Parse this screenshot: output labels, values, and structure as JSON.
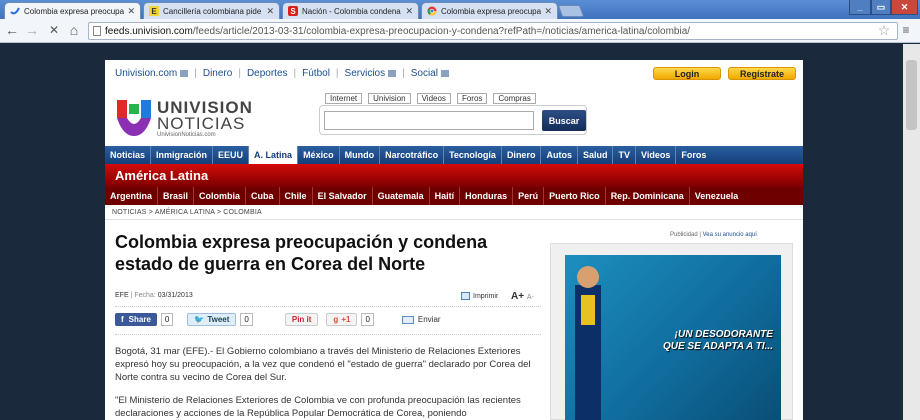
{
  "browser": {
    "tabs": [
      {
        "title": "Colombia expresa preocupa",
        "icon": "univision-icon",
        "active": true
      },
      {
        "title": "Cancillería colombiana pide c",
        "icon": "eltiempo-icon",
        "active": false
      },
      {
        "title": "Nación - Colombia condena",
        "icon": "semana-icon",
        "active": false
      },
      {
        "title": "Colombia expresa preocupa",
        "icon": "chrome-icon",
        "active": false
      }
    ],
    "url_host": "feeds.univision.com",
    "url_path": "/feeds/article/2013-03-31/colombia-expresa-preocupacion-y-condena?refPath=/noticias/america-latina/colombia/"
  },
  "site": {
    "top_links": [
      "Univision.com",
      "Dinero",
      "Deportes",
      "Fútbol",
      "Servicios",
      "Social"
    ],
    "login": "Login",
    "register": "Regístrate",
    "logo_line1": "UNIVISION",
    "logo_line2": "NOTICIAS",
    "logo_line3": "UnivisionNoticias.com",
    "search_tabs": [
      "Internet",
      "Univision",
      "Videos",
      "Foros",
      "Compras"
    ],
    "search_button": "Buscar",
    "main_nav": [
      "Noticias",
      "Inmigración",
      "EEUU",
      "A. Latina",
      "México",
      "Mundo",
      "Narcotráfico",
      "Tecnología",
      "Dinero",
      "Autos",
      "Salud",
      "TV",
      "Videos",
      "Foros"
    ],
    "main_nav_active": "A. Latina",
    "section_title": "América Latina",
    "sub_nav": [
      "Argentina",
      "Brasil",
      "Colombia",
      "Cuba",
      "Chile",
      "El Salvador",
      "Guatemala",
      "Haití",
      "Honduras",
      "Perú",
      "Puerto Rico",
      "Rep. Dominicana",
      "Venezuela"
    ],
    "breadcrumb": "NOTICIAS > AMÉRICA LATINA > COLOMBIA"
  },
  "article": {
    "headline": "Colombia expresa preocupación y condena estado de guerra en Corea del Norte",
    "source": "EFE",
    "date_label": "Fecha:",
    "date": "03/31/2013",
    "print": "Imprimir",
    "font_big": "A+",
    "font_small": "A-",
    "share": {
      "facebook": "Share",
      "facebook_count": "0",
      "twitter": "Tweet",
      "twitter_count": "0",
      "pinterest": "Pin it",
      "gplus": "+1",
      "gplus_count": "0",
      "email": "Enviar"
    },
    "paragraphs": [
      "Bogotá, 31 mar (EFE).- El Gobierno colombiano a través del Ministerio de Relaciones Exteriores expresó hoy su preocupación, a la vez que condenó el \"estado de guerra\" declarado por Corea del Norte contra su vecino de Corea del Sur.",
      "\"El Ministerio de Relaciones Exteriores de Colombia ve con profunda preocupación las recientes declaraciones y acciones de la República Popular Democrática de Corea, poniendo"
    ]
  },
  "ad": {
    "label": "Publicidad |",
    "link": "Vea su anuncio aquí",
    "text_line1": "¡UN DESODORANTE",
    "text_line2": "QUE SE ADAPTA A TI..."
  },
  "colors": {
    "nav_blue": "#143e78",
    "section_red": "#d40a0a",
    "accent_yellow": "#f0a900"
  }
}
